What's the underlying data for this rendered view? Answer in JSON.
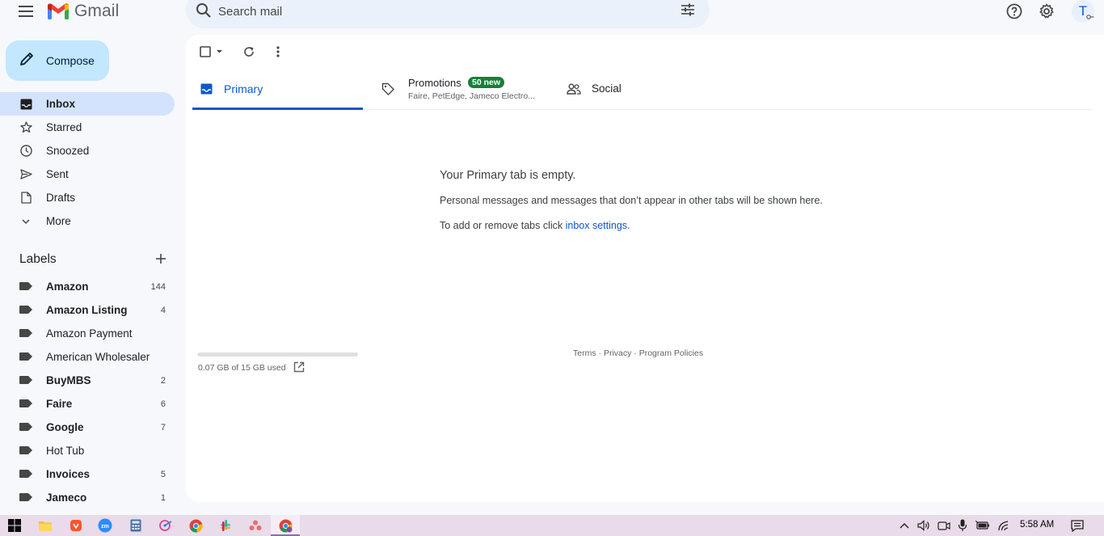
{
  "app": {
    "name": "Gmail"
  },
  "search": {
    "placeholder": "Search mail"
  },
  "compose": {
    "label": "Compose"
  },
  "nav": [
    {
      "label": "Inbox",
      "icon": "inbox-icon",
      "active": true
    },
    {
      "label": "Starred",
      "icon": "star-icon"
    },
    {
      "label": "Snoozed",
      "icon": "clock-icon"
    },
    {
      "label": "Sent",
      "icon": "send-icon"
    },
    {
      "label": "Drafts",
      "icon": "draft-icon"
    },
    {
      "label": "More",
      "icon": "chevron-down-icon"
    }
  ],
  "labels": {
    "title": "Labels",
    "items": [
      {
        "name": "Amazon",
        "count": "144",
        "bold": true
      },
      {
        "name": "Amazon Listing",
        "count": "4",
        "bold": true
      },
      {
        "name": "Amazon Payment",
        "count": "",
        "bold": false
      },
      {
        "name": "American Wholesaler",
        "count": "",
        "bold": false
      },
      {
        "name": "BuyMBS",
        "count": "2",
        "bold": true
      },
      {
        "name": "Faire",
        "count": "6",
        "bold": true
      },
      {
        "name": "Google",
        "count": "7",
        "bold": true
      },
      {
        "name": "Hot Tub",
        "count": "",
        "bold": false
      },
      {
        "name": "Invoices",
        "count": "5",
        "bold": true
      },
      {
        "name": "Jameco",
        "count": "1",
        "bold": true
      }
    ]
  },
  "tabs": {
    "primary": {
      "label": "Primary"
    },
    "promotions": {
      "label": "Promotions",
      "badge": "50 new",
      "senders": "Faire, PetEdge, Jameco Electro..."
    },
    "social": {
      "label": "Social"
    }
  },
  "empty_state": {
    "title": "Your Primary tab is empty.",
    "line1": "Personal messages and messages that don’t appear in other tabs will be shown here.",
    "line2_prefix": "To add or remove tabs click ",
    "line2_link": "inbox settings",
    "line2_suffix": "."
  },
  "storage": {
    "text": "0.07 GB of 15 GB used",
    "used_fraction": 0.0047
  },
  "footer": {
    "terms": "Terms",
    "sep": " · ",
    "privacy": "Privacy",
    "policies": "Program Policies"
  },
  "account": {
    "initial": "T"
  },
  "taskbar": {
    "time": "5:58 AM"
  },
  "colors": {
    "accent": "#0b57d0",
    "compose_bg": "#c2e7ff",
    "active_nav": "#d3e3fd",
    "badge_green": "#188038"
  }
}
